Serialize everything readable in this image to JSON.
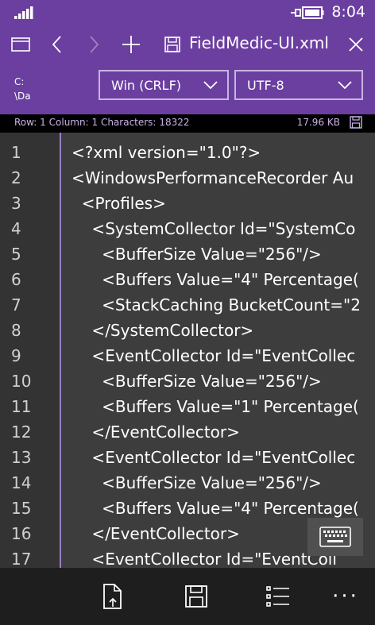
{
  "status": {
    "time": "8:04",
    "signal": "signal-icon",
    "battery": "battery-charging-icon"
  },
  "tabs": {
    "new_window_icon": "window-icon",
    "back_icon": "back-arrow-icon",
    "forward_icon": "forward-arrow-icon",
    "add_icon": "plus-icon",
    "file_icon": "save-icon",
    "filename": "FieldMedic-UI.xml",
    "close_icon": "close-icon"
  },
  "settings": {
    "path_line1": "C:",
    "path_line2": "\\Da",
    "line_ending": "Win (CRLF)",
    "encoding": "UTF-8"
  },
  "info": {
    "row_label": "Row:",
    "row": "1",
    "col_label": "Column:",
    "col": "1",
    "chars_label": "Characters:",
    "chars": "18322",
    "size": "17.96 KB"
  },
  "editor": {
    "lines": [
      {
        "n": "1",
        "text": "<?xml version=\"1.0\"?>"
      },
      {
        "n": "2",
        "text": "<WindowsPerformanceRecorder Au"
      },
      {
        "n": "3",
        "text": "  <Profiles>"
      },
      {
        "n": "4",
        "text": "    <SystemCollector Id=\"SystemCo"
      },
      {
        "n": "5",
        "text": "      <BufferSize Value=\"256\"/>"
      },
      {
        "n": "6",
        "text": "      <Buffers Value=\"4\" Percentage("
      },
      {
        "n": "7",
        "text": "      <StackCaching BucketCount=\"2"
      },
      {
        "n": "8",
        "text": "    </SystemCollector>"
      },
      {
        "n": "9",
        "text": "    <EventCollector Id=\"EventCollec"
      },
      {
        "n": "10",
        "text": "      <BufferSize Value=\"256\"/>"
      },
      {
        "n": "11",
        "text": "      <Buffers Value=\"1\" Percentage("
      },
      {
        "n": "12",
        "text": "    </EventCollector>"
      },
      {
        "n": "13",
        "text": "    <EventCollector Id=\"EventCollec"
      },
      {
        "n": "14",
        "text": "      <BufferSize Value=\"256\"/>"
      },
      {
        "n": "15",
        "text": "      <Buffers Value=\"4\" Percentage("
      },
      {
        "n": "16",
        "text": "    </EventCollector>"
      },
      {
        "n": "17",
        "text": "    <EventCollector Id=\"EventColl"
      }
    ]
  },
  "appbar": {
    "icons": [
      "open-file-icon",
      "save-icon",
      "list-icon"
    ],
    "more": "···"
  }
}
